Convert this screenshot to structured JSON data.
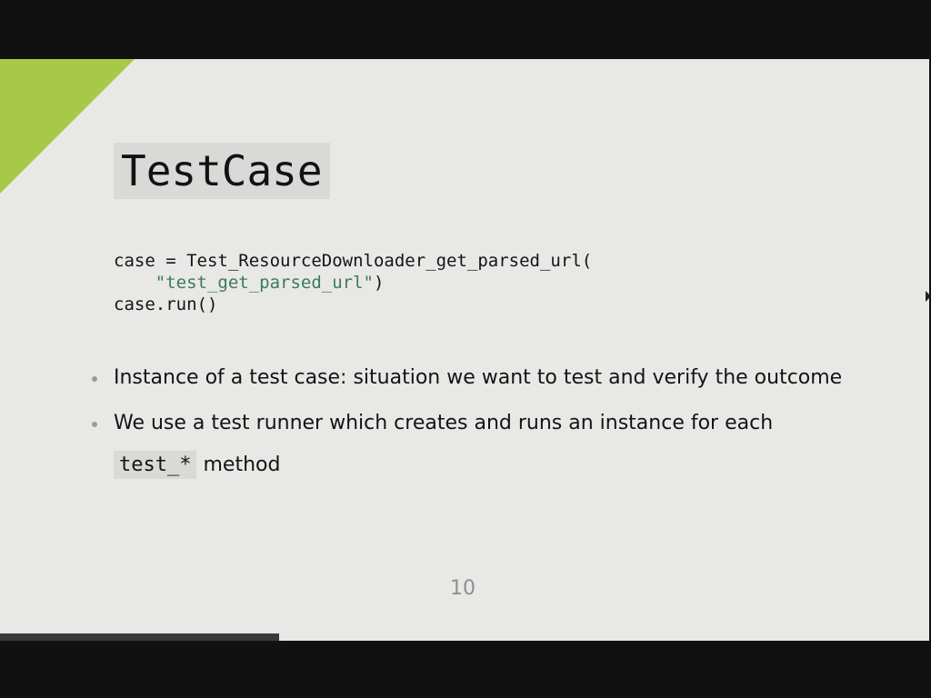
{
  "slide": {
    "title": "TestCase",
    "code": {
      "line1": "case = Test_ResourceDownloader_get_parsed_url(",
      "line2_indent": "    ",
      "line2_string": "\"test_get_parsed_url\"",
      "line2_close": ")",
      "line3": "case.run()"
    },
    "bullets": {
      "item1": "Instance of a test case: situation we want to test and verify the outcome",
      "item2_text": "We use a test runner which creates and runs an instance for each",
      "item2_code": "test_*",
      "item2_suffix": " method"
    },
    "page_number": "10",
    "progress": 0.3,
    "colors": {
      "accent": "#a8c84a",
      "slide_background": "#e8e8e6",
      "string_color": "#3d7b59",
      "progress_color": "#3a3a3a"
    }
  }
}
